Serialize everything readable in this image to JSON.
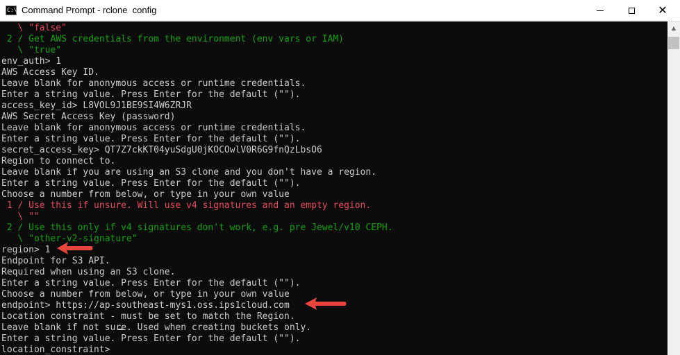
{
  "window": {
    "title": "Command Prompt - rclone  config",
    "icon": "cmd-icon",
    "controls": {
      "minimize": "minimize-icon",
      "maximize": "maximize-icon",
      "close": "close-icon"
    }
  },
  "colors": {
    "background": "#0c0c0c",
    "text_default": "#cccccc",
    "text_green": "#13a10e",
    "text_red": "#e74856",
    "annotation_arrow": "#e8453c"
  },
  "console": {
    "lines": [
      {
        "text": "   \\ \"false\"",
        "color": "red"
      },
      {
        "text": " 2 / Get AWS credentials from the environment (env vars or IAM)",
        "color": "green"
      },
      {
        "text": "   \\ \"true\"",
        "color": "green"
      },
      {
        "text": "env_auth> 1",
        "color": "default"
      },
      {
        "text": "AWS Access Key ID.",
        "color": "default"
      },
      {
        "text": "Leave blank for anonymous access or runtime credentials.",
        "color": "default"
      },
      {
        "text": "Enter a string value. Press Enter for the default (\"\").",
        "color": "default"
      },
      {
        "text": "access_key_id> L8VOL9J1BE9SI4W6ZRJR",
        "color": "default"
      },
      {
        "text": "AWS Secret Access Key (password)",
        "color": "default"
      },
      {
        "text": "Leave blank for anonymous access or runtime credentials.",
        "color": "default"
      },
      {
        "text": "Enter a string value. Press Enter for the default (\"\").",
        "color": "default"
      },
      {
        "text": "secret_access_key> QT7Z7ckKT04yuSdgU0jKOCOwlV0R6G9fnQzLbsO6",
        "color": "default"
      },
      {
        "text": "Region to connect to.",
        "color": "default"
      },
      {
        "text": "Leave blank if you are using an S3 clone and you don't have a region.",
        "color": "default"
      },
      {
        "text": "Enter a string value. Press Enter for the default (\"\").",
        "color": "default"
      },
      {
        "text": "Choose a number from below, or type in your own value",
        "color": "default"
      },
      {
        "text": " 1 / Use this if unsure. Will use v4 signatures and an empty region.",
        "color": "red"
      },
      {
        "text": "   \\ \"\"",
        "color": "red"
      },
      {
        "text": " 2 / Use this only if v4 signatures don't work, e.g. pre Jewel/v10 CEPH.",
        "color": "green"
      },
      {
        "text": "   \\ \"other-v2-signature\"",
        "color": "green"
      },
      {
        "text": "region> 1",
        "color": "default"
      },
      {
        "text": "Endpoint for S3 API.",
        "color": "default"
      },
      {
        "text": "Required when using an S3 clone.",
        "color": "default"
      },
      {
        "text": "Enter a string value. Press Enter for the default (\"\").",
        "color": "default"
      },
      {
        "text": "Choose a number from below, or type in your own value",
        "color": "default"
      },
      {
        "text": "endpoint> https://ap-southeast-mys1.oss.ips1cloud.com",
        "color": "default"
      },
      {
        "text": "Location constraint - must be set to match the Region.",
        "color": "default"
      },
      {
        "text": "Leave blank if not sure. Used when creating buckets only.",
        "color": "default"
      },
      {
        "text": "Enter a string value. Press Enter for the default (\"\").",
        "color": "default"
      },
      {
        "text": "location_constraint> ",
        "color": "default"
      }
    ]
  },
  "annotations": [
    {
      "name": "arrow-region",
      "points_to": "region> 1"
    },
    {
      "name": "arrow-endpoint",
      "points_to": "endpoint> https://ap-southeast-mys1.oss.ips1cloud.com"
    }
  ]
}
